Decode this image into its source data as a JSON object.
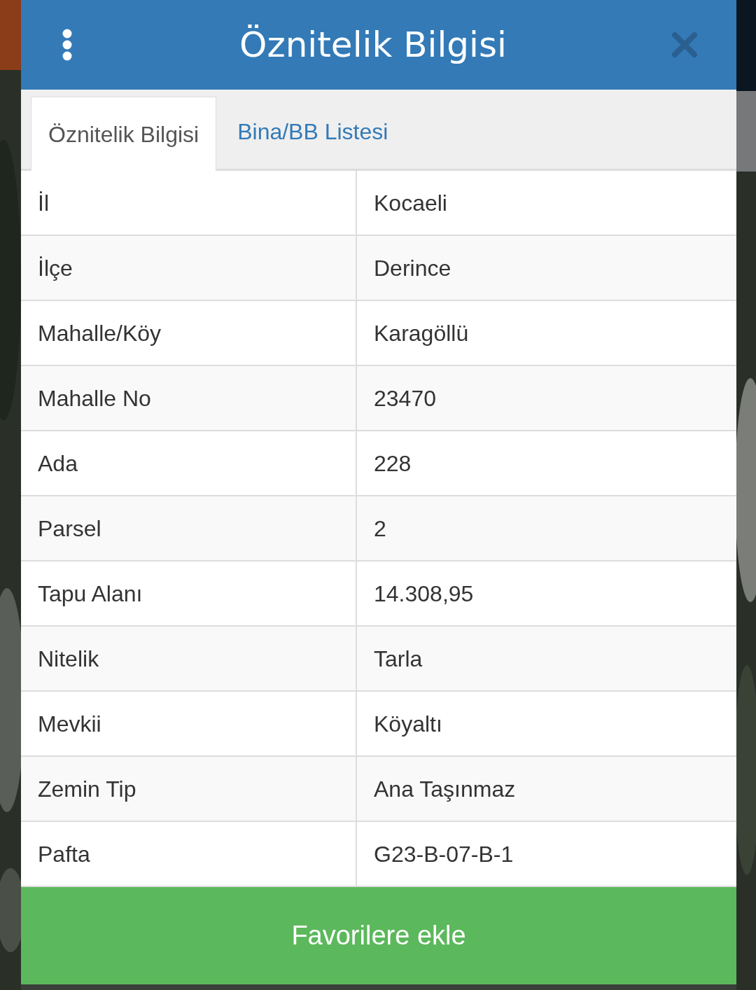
{
  "dialog": {
    "title": "Öznitelik Bilgisi"
  },
  "tabs": [
    {
      "label": "Öznitelik Bilgisi",
      "selected": true
    },
    {
      "label": "Bina/BB Listesi",
      "selected": false
    }
  ],
  "rows": [
    {
      "label": "İl",
      "value": "Kocaeli"
    },
    {
      "label": "İlçe",
      "value": "Derince"
    },
    {
      "label": "Mahalle/Köy",
      "value": "Karagöllü"
    },
    {
      "label": "Mahalle No",
      "value": "23470"
    },
    {
      "label": "Ada",
      "value": "228"
    },
    {
      "label": "Parsel",
      "value": "2"
    },
    {
      "label": "Tapu Alanı",
      "value": "14.308,95"
    },
    {
      "label": "Nitelik",
      "value": "Tarla"
    },
    {
      "label": "Mevkii",
      "value": "Köyaltı"
    },
    {
      "label": "Zemin Tip",
      "value": "Ana Taşınmaz"
    },
    {
      "label": "Pafta",
      "value": "G23-B-07-B-1"
    }
  ],
  "action_button": "Favorilere ekle"
}
